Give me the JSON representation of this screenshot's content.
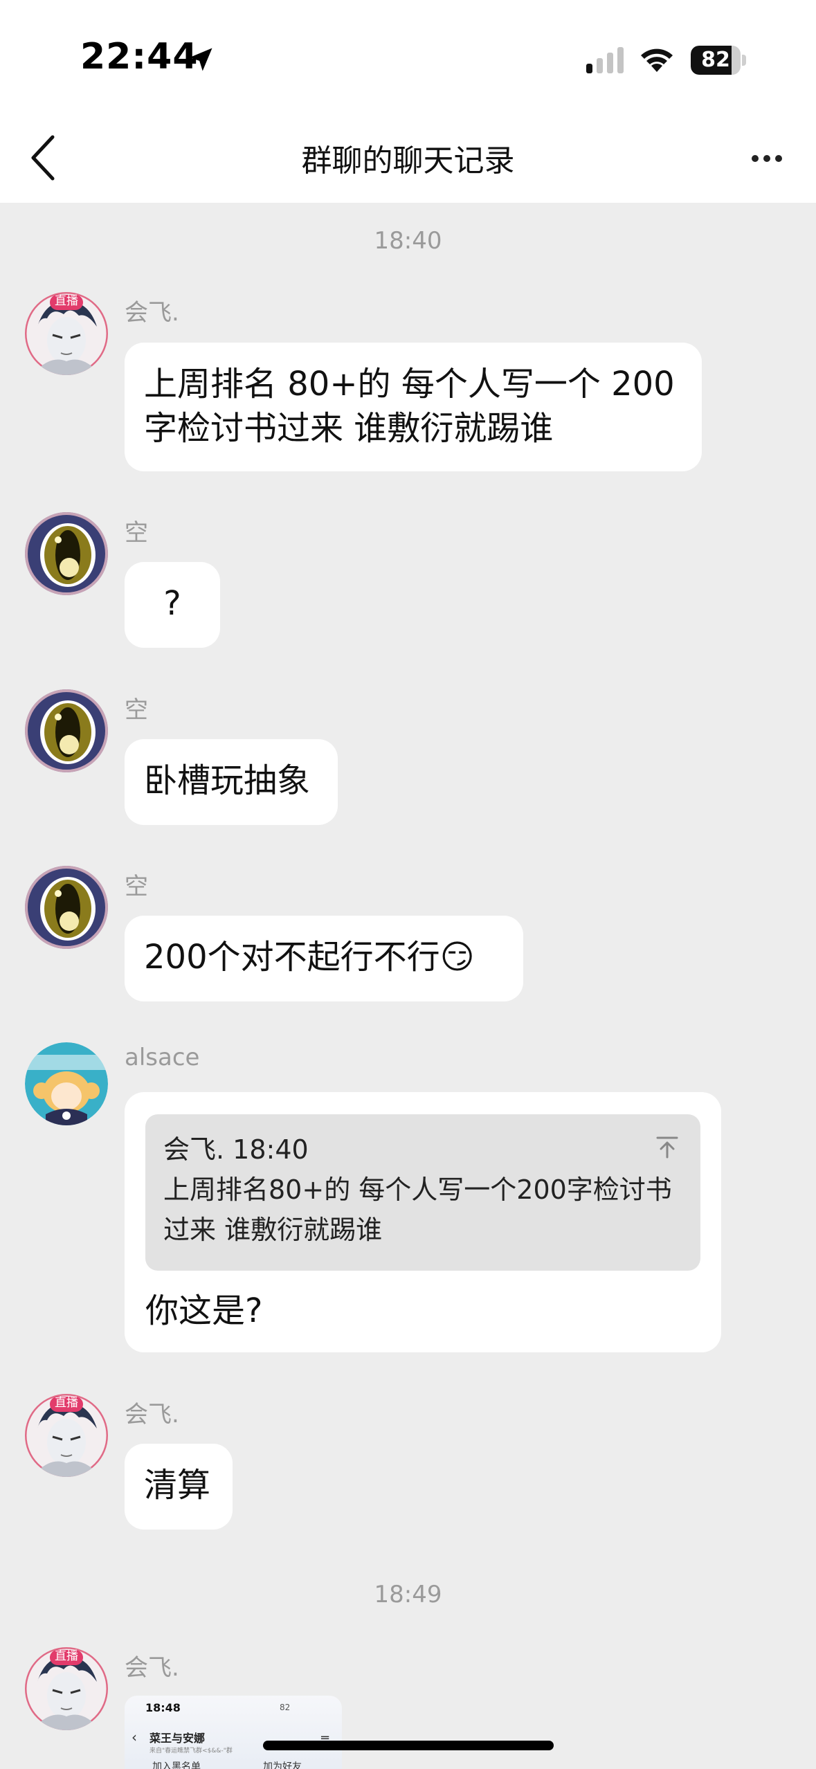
{
  "status": {
    "time": "22:44",
    "battery": "82",
    "battery_level": 0.82
  },
  "nav": {
    "title": "群聊的聊天记录"
  },
  "timestamps": [
    "18:40",
    "18:49"
  ],
  "messages": [
    {
      "sender": "会飞.",
      "text": "上周排名 80+的 每个人写一个 200\n字检讨书过来 谁敷衍就踢谁",
      "avatar": "anime-avatar-live",
      "live_badge": "直播"
    },
    {
      "sender": "空",
      "text": "?",
      "avatar": "eye-avatar"
    },
    {
      "sender": "空",
      "text": "卧槽玩抽象",
      "avatar": "eye-avatar"
    },
    {
      "sender": "空",
      "text": "200个对不起行不行😏",
      "avatar": "eye-avatar"
    },
    {
      "sender": "alsace",
      "avatar": "chibi-avatar",
      "quote": {
        "header": "会飞. 18:40",
        "text": "上周排名80+的 每个人写一个200字检讨书\n过来 谁敷衍就踢谁"
      },
      "text": "你这是?"
    },
    {
      "sender": "会飞.",
      "text": "清算",
      "avatar": "anime-avatar-live",
      "live_badge": "直播"
    },
    {
      "sender": "会飞.",
      "avatar": "anime-avatar-live",
      "live_badge": "直播",
      "image": {
        "time": "18:48",
        "status": "82",
        "title": "菜王与安娜",
        "subtitle": "来自\"春运瞧禁飞群<$&&-\"群",
        "block": "加入黑名单",
        "add": "加为好友"
      }
    }
  ],
  "colors": {
    "background": "#ededed",
    "bubble": "#ffffff",
    "quote": "#e2e2e2",
    "meta_text": "#9a9a9a"
  }
}
